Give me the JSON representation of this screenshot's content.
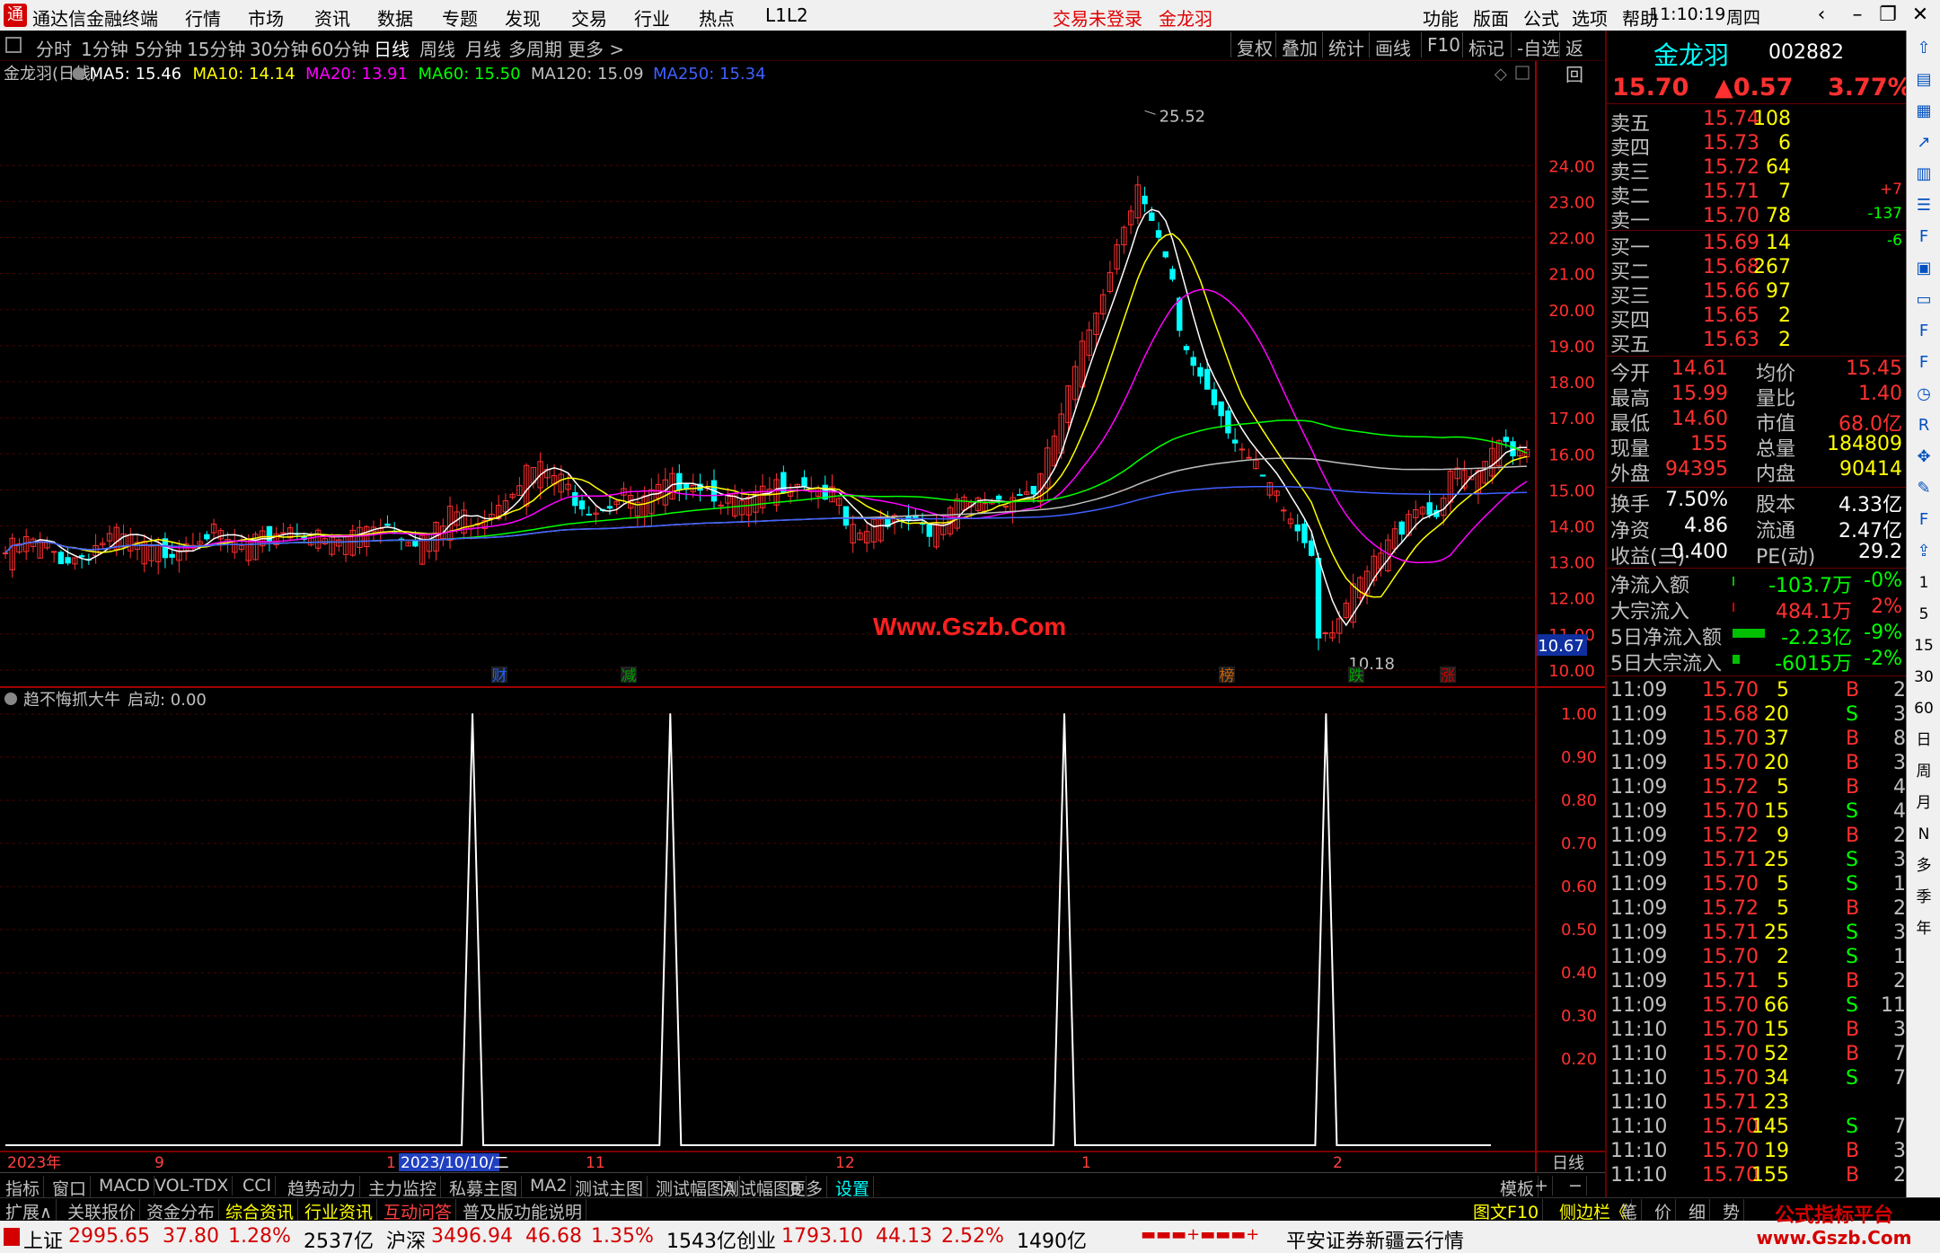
{
  "titlebar": {
    "app": "通达信金融终端",
    "menu": [
      "行情",
      "市场",
      "资讯",
      "数据",
      "专题",
      "发现",
      "交易",
      "行业",
      "热点",
      "L1L2"
    ],
    "login": "交易未登录",
    "stock": "金龙羽",
    "right_menu": [
      "功能",
      "版面",
      "公式",
      "选项",
      "帮助"
    ],
    "time": "11:10:19",
    "weekday": "周四"
  },
  "periods": [
    "分时",
    "1分钟",
    "5分钟",
    "15分钟",
    "30分钟",
    "60分钟",
    "日线",
    "周线",
    "月线",
    "多周期",
    "更多 >"
  ],
  "active_period": "日线",
  "chart_tools": [
    "复权",
    "叠加",
    "统计",
    "画线",
    "F10",
    "标记",
    "-自选",
    "返回"
  ],
  "ma_legend": [
    {
      "label": "金龙羽(日线)",
      "color": "#c0c0c0"
    },
    {
      "label": "MA5: 15.46",
      "color": "#ffffff"
    },
    {
      "label": "MA10: 14.14",
      "color": "#ffff00"
    },
    {
      "label": "MA20: 13.91",
      "color": "#ff00ff"
    },
    {
      "label": "MA60: 15.50",
      "color": "#00ff00"
    },
    {
      "label": "MA120: 15.09",
      "color": "#c0c0c0"
    },
    {
      "label": "MA250: 15.34",
      "color": "#4060ff"
    }
  ],
  "main_axis": {
    "labels": [
      "24.00",
      "23.00",
      "22.00",
      "21.00",
      "20.00",
      "19.00",
      "18.00",
      "17.00",
      "16.00",
      "15.00",
      "14.00",
      "13.00",
      "12.00",
      "11.00",
      "10.00"
    ],
    "values": [
      24,
      23,
      22,
      21,
      20,
      19,
      18,
      17,
      16,
      15,
      14,
      13,
      12,
      11,
      10
    ],
    "ymin": 9.9,
    "ymax": 26.6,
    "current": "10.67",
    "current_value": 10.67
  },
  "annotations": {
    "high": "25.52",
    "low": "10.18"
  },
  "event_tags": [
    {
      "text": "财",
      "color": "#2060ff"
    },
    {
      "text": "减",
      "color": "#00a000"
    },
    {
      "text": "榜",
      "color": "#d06000"
    },
    {
      "text": "跌",
      "color": "#00a000"
    },
    {
      "text": "涨",
      "color": "#d00000"
    }
  ],
  "indicator": {
    "name": "趋不悔抓大牛",
    "param": "启动: 0.00",
    "axis": [
      "1.00",
      "0.90",
      "0.80",
      "0.70",
      "0.60",
      "0.50",
      "0.40",
      "0.30",
      "0.20"
    ],
    "axis_values": [
      1.0,
      0.9,
      0.8,
      0.7,
      0.6,
      0.5,
      0.4,
      0.3,
      0.2
    ]
  },
  "chart_data": {
    "type": "line",
    "title": "趋不悔抓大牛",
    "series": [
      {
        "name": "启动",
        "spikes_at_bar_fraction": [
          0.307,
          0.437,
          0.696,
          0.868
        ],
        "values_peak": 1.0
      }
    ]
  },
  "time_axis": [
    {
      "label": "2023年",
      "color": "#ff4040"
    },
    {
      "label": "9",
      "color": "#ff4040"
    },
    {
      "label": "1",
      "color": "#ff4040"
    },
    {
      "label": "2023/10/10/二",
      "color": "#ffffff",
      "bg": "#2040c0"
    },
    {
      "label": "11",
      "color": "#ff4040"
    },
    {
      "label": "12",
      "color": "#ff4040"
    },
    {
      "label": "1",
      "color": "#ff4040"
    },
    {
      "label": "2",
      "color": "#ff4040"
    }
  ],
  "time_axis_right": "日线",
  "tabs": [
    "指标",
    "窗口",
    "MACD",
    "VOL-TDX",
    "CCI",
    "趋势动力",
    "主力监控",
    "私募主图",
    "MA2",
    "测试主图",
    "测试幅图A",
    "测试幅图B",
    "更多",
    "设置"
  ],
  "tabs_right": [
    "模板",
    "+",
    "−"
  ],
  "ext_tabs": [
    {
      "t": "扩展∧",
      "c": "#c0c0c0"
    },
    {
      "t": "关联报价",
      "c": "#c0c0c0"
    },
    {
      "t": "资金分布",
      "c": "#c0c0c0"
    },
    {
      "t": "综合资讯",
      "c": "#ffff00"
    },
    {
      "t": "行业资讯",
      "c": "#ffff00"
    },
    {
      "t": "互动问答",
      "c": "#ff4040"
    },
    {
      "t": "普及版功能说明",
      "c": "#c0c0c0"
    }
  ],
  "ext_right": [
    "图文F10",
    "侧边栏《",
    "笔",
    "价",
    "细",
    "势"
  ],
  "quote": {
    "name": "金龙羽",
    "code": "002882",
    "price": "15.70",
    "change": "▲0.57",
    "pct": "3.77%",
    "asks": [
      [
        "卖五",
        "15.74",
        "108",
        ""
      ],
      [
        "卖四",
        "15.73",
        "6",
        ""
      ],
      [
        "卖三",
        "15.72",
        "64",
        ""
      ],
      [
        "卖二",
        "15.71",
        "7",
        "+7"
      ],
      [
        "卖一",
        "15.70",
        "78",
        "-137"
      ]
    ],
    "bids": [
      [
        "买一",
        "15.69",
        "14",
        "-6"
      ],
      [
        "买二",
        "15.68",
        "267",
        ""
      ],
      [
        "买三",
        "15.66",
        "97",
        ""
      ],
      [
        "买四",
        "15.65",
        "2",
        ""
      ],
      [
        "买五",
        "15.63",
        "2",
        ""
      ]
    ],
    "stats": [
      [
        "今开",
        "14.61",
        "均价",
        "15.45"
      ],
      [
        "最高",
        "15.99",
        "量比",
        "1.40"
      ],
      [
        "最低",
        "14.60",
        "市值",
        "68.0亿"
      ],
      [
        "现量",
        "155",
        "总量",
        "184809"
      ],
      [
        "外盘",
        "94395",
        "内盘",
        "90414"
      ]
    ],
    "stats2": [
      [
        "换手",
        "7.50%",
        "股本",
        "4.33亿"
      ],
      [
        "净资",
        "4.86",
        "流通",
        "2.47亿"
      ],
      [
        "收益(三)",
        "0.400",
        "PE(动)",
        "29.2"
      ]
    ],
    "flows": [
      [
        "净流入额",
        "-103.7万",
        "-0%"
      ],
      [
        "大宗流入",
        "484.1万",
        "2%"
      ],
      [
        "5日净流入额",
        "-2.23亿",
        "-9%"
      ],
      [
        "5日大宗流入",
        "-6015万",
        "-2%"
      ]
    ],
    "ticks": [
      [
        "11:09",
        "15.70",
        "5",
        "B",
        "2"
      ],
      [
        "11:09",
        "15.68",
        "20",
        "S",
        "3"
      ],
      [
        "11:09",
        "15.70",
        "37",
        "B",
        "8"
      ],
      [
        "11:09",
        "15.70",
        "20",
        "B",
        "3"
      ],
      [
        "11:09",
        "15.72",
        "5",
        "B",
        "4"
      ],
      [
        "11:09",
        "15.70",
        "15",
        "S",
        "4"
      ],
      [
        "11:09",
        "15.72",
        "9",
        "B",
        "2"
      ],
      [
        "11:09",
        "15.71",
        "25",
        "S",
        "3"
      ],
      [
        "11:09",
        "15.70",
        "5",
        "S",
        "1"
      ],
      [
        "11:09",
        "15.72",
        "5",
        "B",
        "2"
      ],
      [
        "11:09",
        "15.71",
        "25",
        "S",
        "3"
      ],
      [
        "11:09",
        "15.70",
        "2",
        "S",
        "1"
      ],
      [
        "11:09",
        "15.71",
        "5",
        "B",
        "2"
      ],
      [
        "11:09",
        "15.70",
        "66",
        "S",
        "11"
      ],
      [
        "11:10",
        "15.70",
        "15",
        "B",
        "3"
      ],
      [
        "11:10",
        "15.70",
        "52",
        "B",
        "7"
      ],
      [
        "11:10",
        "15.70",
        "34",
        "S",
        "7"
      ],
      [
        "11:10",
        "15.71",
        "23",
        "",
        ""
      ],
      [
        "11:10",
        "15.70",
        "145",
        "S",
        "7"
      ],
      [
        "11:10",
        "15.70",
        "19",
        "B",
        "3"
      ],
      [
        "11:10",
        "15.70",
        "155",
        "B",
        "2"
      ]
    ]
  },
  "status": [
    {
      "n": "上证",
      "v": "2995.65",
      "c": "37.80",
      "p": "1.28%",
      "a": "2537亿"
    },
    {
      "n": "沪深",
      "v": "3496.94",
      "c": "46.68",
      "p": "1.35%",
      "a": "1543亿"
    },
    {
      "n": "创业",
      "v": "1793.10",
      "c": "44.13",
      "p": "2.52%",
      "a": "1490亿"
    }
  ],
  "status_right": "平安证券新疆云行情",
  "sidebar_icons": [
    "up-arrow-icon",
    "chart-icon",
    "grid-icon",
    "line-icon",
    "kline-icon",
    "list-icon",
    "f10-icon",
    "news-icon",
    "doc-icon",
    "f2-icon",
    "f3-icon",
    "clock-icon",
    "rsi-icon",
    "move-icon",
    "pen-icon",
    "f5-icon",
    "share-icon",
    "1",
    "5",
    "15",
    "30",
    "60",
    "日",
    "周",
    "月",
    "N",
    "多",
    "季",
    "年"
  ],
  "watermark": "Www.Gszb.Com",
  "watermark2": [
    "公式指标平台",
    "www.Gszb.Com"
  ]
}
